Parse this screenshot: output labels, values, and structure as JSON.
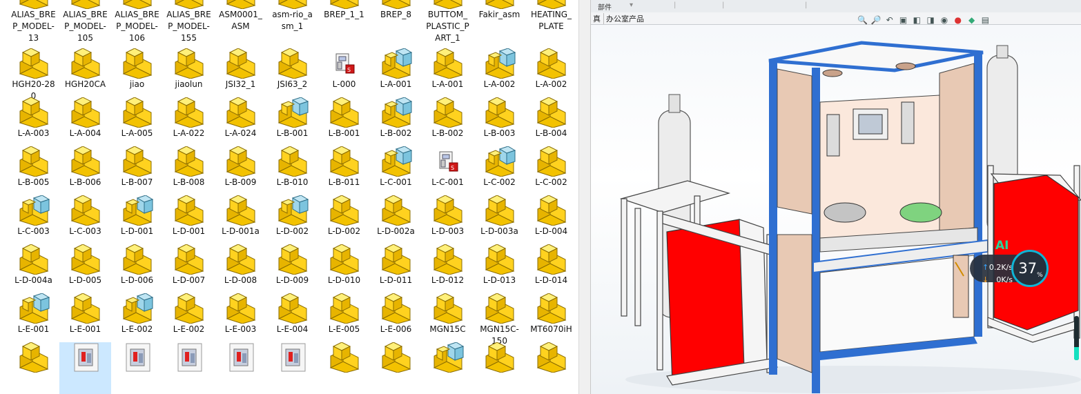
{
  "explorer": {
    "files": [
      {
        "label": "ALIAS_BRE\nP_MODEL-\n13",
        "icon": "assembly-icon"
      },
      {
        "label": "ALIAS_BRE\nP_MODEL-\n105",
        "icon": "assembly-icon"
      },
      {
        "label": "ALIAS_BRE\nP_MODEL-\n106",
        "icon": "assembly-icon"
      },
      {
        "label": "ALIAS_BRE\nP_MODEL-\n155",
        "icon": "assembly-icon"
      },
      {
        "label": "ASM0001_\nASM",
        "icon": "assembly-icon"
      },
      {
        "label": "asm-rio_a\nsm_1",
        "icon": "assembly-icon"
      },
      {
        "label": "BREP_1_1",
        "icon": "assembly-icon"
      },
      {
        "label": "BREP_8",
        "icon": "assembly-icon"
      },
      {
        "label": "BUTTOM_\nPLASTIC_P\nART_1",
        "icon": "assembly-icon"
      },
      {
        "label": "Fakir_asm",
        "icon": "assembly-icon"
      },
      {
        "label": "HEATING_\nPLATE",
        "icon": "assembly-icon"
      },
      {
        "label": "HGH20-28\n0",
        "icon": "part-icon"
      },
      {
        "label": "HGH20CA",
        "icon": "part-icon"
      },
      {
        "label": "jiao",
        "icon": "part-icon"
      },
      {
        "label": "jiaolun",
        "icon": "part-icon"
      },
      {
        "label": "JSI32_1",
        "icon": "part-icon"
      },
      {
        "label": "JSI63_2",
        "icon": "part-icon"
      },
      {
        "label": "L-000",
        "icon": "drawing-thumbnail-icon"
      },
      {
        "label": "L-A-001",
        "icon": "assembly-icon"
      },
      {
        "label": "L-A-001",
        "icon": "part-icon"
      },
      {
        "label": "L-A-002",
        "icon": "assembly-icon"
      },
      {
        "label": "L-A-002",
        "icon": "part-icon"
      },
      {
        "label": "L-A-003",
        "icon": "part-icon"
      },
      {
        "label": "L-A-004",
        "icon": "part-icon"
      },
      {
        "label": "L-A-005",
        "icon": "part-icon"
      },
      {
        "label": "L-A-022",
        "icon": "part-icon"
      },
      {
        "label": "L-A-024",
        "icon": "part-icon"
      },
      {
        "label": "L-B-001",
        "icon": "assembly-icon"
      },
      {
        "label": "L-B-001",
        "icon": "part-icon"
      },
      {
        "label": "L-B-002",
        "icon": "assembly-icon"
      },
      {
        "label": "L-B-002",
        "icon": "part-icon"
      },
      {
        "label": "L-B-003",
        "icon": "part-icon"
      },
      {
        "label": "L-B-004",
        "icon": "part-icon"
      },
      {
        "label": "L-B-005",
        "icon": "part-icon"
      },
      {
        "label": "L-B-006",
        "icon": "part-icon"
      },
      {
        "label": "L-B-007",
        "icon": "part-icon"
      },
      {
        "label": "L-B-008",
        "icon": "part-icon"
      },
      {
        "label": "L-B-009",
        "icon": "part-icon"
      },
      {
        "label": "L-B-010",
        "icon": "part-icon"
      },
      {
        "label": "L-B-011",
        "icon": "part-icon"
      },
      {
        "label": "L-C-001",
        "icon": "assembly-icon"
      },
      {
        "label": "L-C-001",
        "icon": "drawing-thumbnail-icon"
      },
      {
        "label": "L-C-002",
        "icon": "assembly-icon"
      },
      {
        "label": "L-C-002",
        "icon": "part-icon"
      },
      {
        "label": "L-C-003",
        "icon": "assembly-icon"
      },
      {
        "label": "L-C-003",
        "icon": "part-icon"
      },
      {
        "label": "L-D-001",
        "icon": "assembly-icon"
      },
      {
        "label": "L-D-001",
        "icon": "part-icon"
      },
      {
        "label": "L-D-001a",
        "icon": "part-icon"
      },
      {
        "label": "L-D-002",
        "icon": "assembly-icon"
      },
      {
        "label": "L-D-002",
        "icon": "part-icon"
      },
      {
        "label": "L-D-002a",
        "icon": "part-icon"
      },
      {
        "label": "L-D-003",
        "icon": "part-icon"
      },
      {
        "label": "L-D-003a",
        "icon": "part-icon"
      },
      {
        "label": "L-D-004",
        "icon": "part-icon"
      },
      {
        "label": "L-D-004a",
        "icon": "part-icon"
      },
      {
        "label": "L-D-005",
        "icon": "part-icon"
      },
      {
        "label": "L-D-006",
        "icon": "part-icon"
      },
      {
        "label": "L-D-007",
        "icon": "part-icon"
      },
      {
        "label": "L-D-008",
        "icon": "part-icon"
      },
      {
        "label": "L-D-009",
        "icon": "part-icon"
      },
      {
        "label": "L-D-010",
        "icon": "part-icon"
      },
      {
        "label": "L-D-011",
        "icon": "part-icon"
      },
      {
        "label": "L-D-012",
        "icon": "part-icon"
      },
      {
        "label": "L-D-013",
        "icon": "part-icon"
      },
      {
        "label": "L-D-014",
        "icon": "part-icon"
      },
      {
        "label": "L-E-001",
        "icon": "assembly-icon"
      },
      {
        "label": "L-E-001",
        "icon": "part-icon"
      },
      {
        "label": "L-E-002",
        "icon": "assembly-icon"
      },
      {
        "label": "L-E-002",
        "icon": "part-icon"
      },
      {
        "label": "L-E-003",
        "icon": "part-icon"
      },
      {
        "label": "L-E-004",
        "icon": "part-icon"
      },
      {
        "label": "L-E-005",
        "icon": "part-icon"
      },
      {
        "label": "L-E-006",
        "icon": "part-icon"
      },
      {
        "label": "MGN15C",
        "icon": "part-icon"
      },
      {
        "label": "MGN15C-\n150",
        "icon": "part-icon"
      },
      {
        "label": "MT6070iH",
        "icon": "part-icon"
      },
      {
        "label": "",
        "icon": "part-icon"
      },
      {
        "label": "",
        "icon": "image-thumbnail-icon",
        "selected": true
      },
      {
        "label": "",
        "icon": "image-thumbnail-icon"
      },
      {
        "label": "",
        "icon": "image-thumbnail-icon"
      },
      {
        "label": "",
        "icon": "image-thumbnail-icon"
      },
      {
        "label": "",
        "icon": "image-thumbnail-icon"
      },
      {
        "label": "",
        "icon": "part-icon"
      },
      {
        "label": "",
        "icon": "part-icon"
      },
      {
        "label": "",
        "icon": "assembly-icon"
      },
      {
        "label": "",
        "icon": "part-icon"
      },
      {
        "label": "",
        "icon": "part-icon"
      }
    ]
  },
  "solidworks": {
    "menubar": {
      "item1": "部件"
    },
    "tabs": {
      "tab1": "真",
      "tab2": "办公室产品"
    },
    "heads_up_icons": [
      "zoom-to-fit-icon",
      "zoom-area-icon",
      "previous-view-icon",
      "section-view-icon",
      "view-orientation-icon",
      "display-style-icon",
      "hide-show-icon",
      "edit-appearance-icon",
      "apply-scene-icon",
      "view-settings-icon"
    ],
    "colors": {
      "frame_blue": "#2f6fd1",
      "panel_red": "#ff0000",
      "panel_tan": "#e8c9b4",
      "cylinder_gray": "#e6e6e6"
    }
  },
  "overlay": {
    "ai_label": "AI",
    "upload_rate": "0.2K/s",
    "download_rate": "0K/s",
    "cpu_percent": "37",
    "cpu_unit": "%",
    "memory_level": 0.3
  }
}
